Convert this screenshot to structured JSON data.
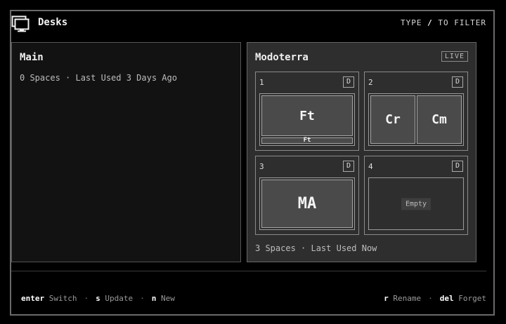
{
  "header": {
    "title": "Desks",
    "hint_type": "TYPE",
    "hint_slash": "/",
    "hint_to": "TO FILTER",
    "icon": "monitor-icon"
  },
  "desks": [
    {
      "name": "Main",
      "meta": "0 Spaces · Last Used 3 Days Ago"
    },
    {
      "name": "Modoterra",
      "meta": "3 Spaces · Last Used Now",
      "badge": "LIVE"
    }
  ],
  "spaces": [
    {
      "number": "1",
      "badge": "D",
      "windows": [
        "Ft"
      ],
      "strip_label": "Ft"
    },
    {
      "number": "2",
      "badge": "D",
      "windows": [
        "Cr",
        "Cm"
      ]
    },
    {
      "number": "3",
      "badge": "D",
      "windows": [
        "MA"
      ]
    },
    {
      "number": "4",
      "badge": "D",
      "empty_label": "Empty"
    }
  ],
  "footer": {
    "left": [
      {
        "key": "enter",
        "label": "Switch"
      },
      {
        "key": "s",
        "label": "Update"
      },
      {
        "key": "n",
        "label": "New"
      }
    ],
    "right": [
      {
        "key": "r",
        "label": "Rename"
      },
      {
        "key": "del",
        "label": "Forget"
      }
    ],
    "separator": "·"
  },
  "colors": {
    "background": "#000000",
    "frame": "#6a6a6a",
    "live_desk": "#2e2e2e",
    "window": "#4a4a4a"
  }
}
